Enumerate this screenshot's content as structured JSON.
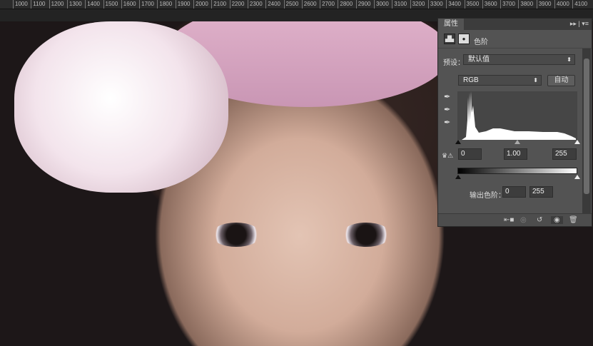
{
  "ruler": {
    "labels": [
      "1000",
      "1100",
      "1200",
      "1300",
      "1400",
      "1500",
      "1600",
      "1700",
      "1800",
      "1900",
      "2000",
      "2100",
      "2200",
      "2300",
      "2400",
      "2500",
      "2600",
      "2700",
      "2800",
      "2900",
      "3000",
      "3100",
      "3200",
      "3300",
      "3400",
      "3500",
      "3600",
      "3700",
      "3800",
      "3900",
      "4000",
      "4100"
    ]
  },
  "panel": {
    "tab_label": "属性",
    "adjustment_title": "色阶",
    "preset_label": "预设：",
    "preset_value": "默认值",
    "channel_value": "RGB",
    "auto_button": "自动",
    "input_black": "0",
    "input_gamma": "1.00",
    "input_white": "255",
    "output_label": "输出色阶：",
    "output_black": "0",
    "output_white": "255"
  },
  "icons": [
    "levels-icon",
    "mask-icon",
    "black-eyedropper-icon",
    "gray-eyedropper-icon",
    "white-eyedropper-icon",
    "clipping-warning-icon",
    "clip-to-layer-icon",
    "view-previous-icon",
    "reset-icon",
    "visibility-icon",
    "trash-icon"
  ]
}
